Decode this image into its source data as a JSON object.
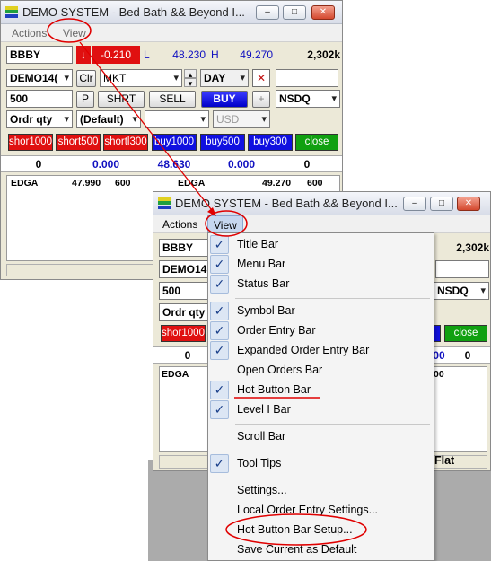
{
  "window_title": "DEMO SYSTEM - Bed Bath && Beyond I...",
  "menus": {
    "actions": "Actions",
    "view": "View"
  },
  "symbol_bar": {
    "symbol": "BBBY",
    "change_arrow": "↓",
    "change": "-0.210",
    "low_label": "L",
    "low": "48.230",
    "high_label": "H",
    "high": "49.270",
    "volume": "2,302k"
  },
  "order_entry": {
    "account": "DEMO14(",
    "clr_label": "Clr",
    "order_type": "MKT",
    "tif": "DAY",
    "quantity": "500",
    "p_label": "P",
    "short_label": "SHRT",
    "sell_label": "SELL",
    "buy_label": "BUY",
    "plus_label": "+",
    "route": "NSDQ",
    "qty_mode": "Ordr qty",
    "profile": "(Default)",
    "currency": "USD"
  },
  "hot_buttons": [
    {
      "label": "shor1000",
      "color": "#e01010"
    },
    {
      "label": "short500",
      "color": "#e01010"
    },
    {
      "label": "shortl300",
      "color": "#e01010"
    },
    {
      "label": "buy1000",
      "color": "#1010e0"
    },
    {
      "label": "buy500",
      "color": "#1010e0"
    },
    {
      "label": "buy300",
      "color": "#1010e0"
    },
    {
      "label": "close",
      "color": "#10a010"
    }
  ],
  "level1": {
    "bid_size": "0",
    "bid": "0.000",
    "last": "48.630",
    "ask": "0.000",
    "ask_size": "0"
  },
  "quotes": {
    "left": {
      "mm": "EDGA",
      "price": "47.990",
      "size": "600"
    },
    "right": {
      "mm": "EDGA",
      "price": "49.270",
      "size": "600"
    }
  },
  "front_window": {
    "symbol": "BBBY",
    "volume": "2,302k",
    "account": "DEMO14(",
    "quantity": "500",
    "route": "NSDQ",
    "qty_mode": "Ordr qty",
    "hot_first": "shor1000",
    "hot_last": "close",
    "level1_left": "0",
    "level1_right": "0",
    "level1_ask_partial": "00",
    "quote_mm": "EDGA",
    "quote_price_partial": "00",
    "status_partial": "Flat"
  },
  "view_menu": {
    "group1": [
      {
        "label": "Title Bar",
        "checked": true
      },
      {
        "label": "Menu Bar",
        "checked": true
      },
      {
        "label": "Status Bar",
        "checked": true
      }
    ],
    "group2": [
      {
        "label": "Symbol Bar",
        "checked": true
      },
      {
        "label": "Order Entry Bar",
        "checked": true
      },
      {
        "label": "Expanded Order Entry Bar",
        "checked": true
      },
      {
        "label": "Open Orders Bar",
        "checked": false
      },
      {
        "label": "Hot Button Bar",
        "checked": true
      },
      {
        "label": "Level I Bar",
        "checked": true
      }
    ],
    "group3": [
      {
        "label": "Scroll Bar",
        "checked": false
      }
    ],
    "group4": [
      {
        "label": "Tool Tips",
        "checked": true
      }
    ],
    "group5": [
      {
        "label": "Settings...",
        "checked": false
      },
      {
        "label": "Local Order Entry Settings...",
        "checked": false
      },
      {
        "label": "Hot Button Bar Setup...",
        "checked": false
      },
      {
        "label": "Save Current as Default",
        "checked": false
      }
    ],
    "check_glyph": "✓"
  },
  "annotation_color": "#e00000",
  "icons": {
    "minimize": "–",
    "maximize": "□",
    "close": "✕",
    "cancel": "✕",
    "spin_up": "▴",
    "spin_down": "▾"
  }
}
